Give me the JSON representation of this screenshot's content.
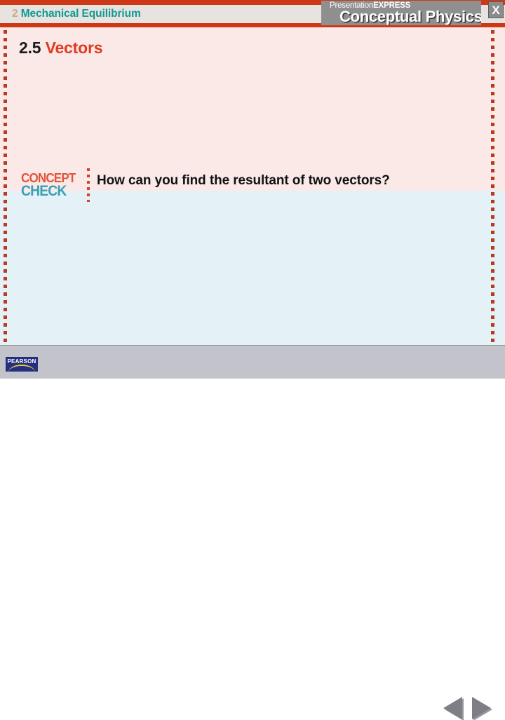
{
  "header": {
    "chapter_number": "2",
    "chapter_title": "Mechanical Equilibrium",
    "brand_prefix": "Presentation",
    "brand_suffix": "EXPRESS",
    "brand_product": "Conceptual Physics",
    "close_label": "X",
    "chapter_number_color": "#cdab7e",
    "chapter_title_color": "#119a91",
    "rule_color": "#cf3817"
  },
  "slide": {
    "section_number": "2.5",
    "section_title": "Vectors",
    "section_title_color": "#e03a20",
    "background_top_color": "#fbe9e7",
    "background_bottom_color": "#e4f1f6",
    "rail_color": "#b83a21"
  },
  "concept_check": {
    "word_top": "CONCEPT",
    "word_bottom": "CHECK",
    "word_top_color": "#e0543c",
    "word_bottom_color": "#3a9fb3",
    "question": "How can you find the resultant of two vectors?"
  },
  "footer": {
    "publisher": "PEARSON",
    "publisher_bg_color": "#24307e",
    "prev_label": "Previous slide",
    "next_label": "Next slide",
    "background_color": "#c3c3cb"
  }
}
